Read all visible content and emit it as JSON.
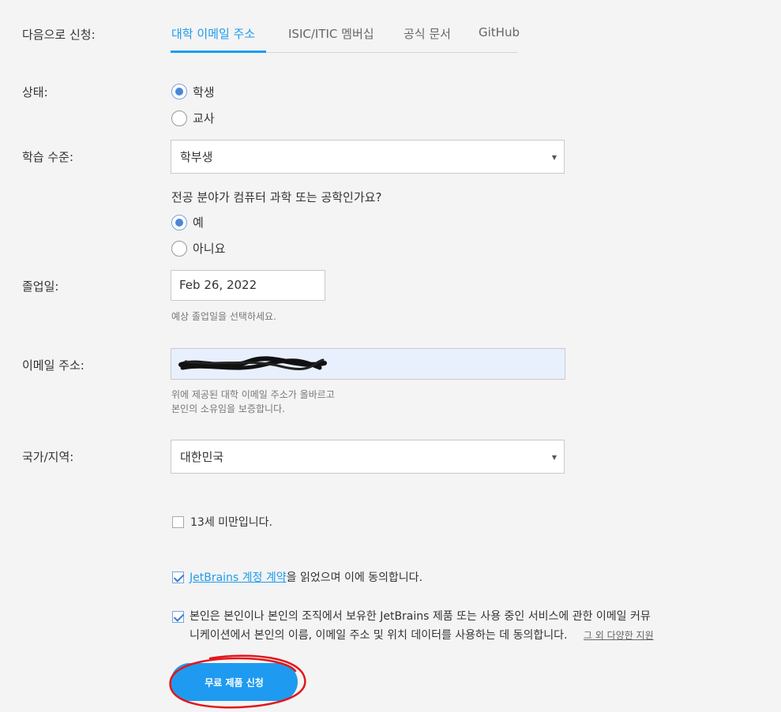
{
  "form": {
    "apply_with_label": "다음으로 신청:",
    "tabs": [
      {
        "label": "대학 이메일 주소",
        "active": true
      },
      {
        "label": "ISIC/ITIC 멤버십",
        "active": false
      },
      {
        "label": "공식 문서",
        "active": false
      },
      {
        "label": "GitHub",
        "active": false
      }
    ],
    "status": {
      "label": "상태:",
      "options": [
        {
          "label": "학생",
          "checked": true
        },
        {
          "label": "교사",
          "checked": false
        }
      ]
    },
    "study_level": {
      "label": "학습 수준:",
      "value": "학부생"
    },
    "major_question": {
      "label": "전공 분야가 컴퓨터 과학 또는 공학인가요?",
      "options": [
        {
          "label": "예",
          "checked": true
        },
        {
          "label": "아니요",
          "checked": false
        }
      ]
    },
    "graduation": {
      "label": "졸업일:",
      "value": "Feb 26, 2022",
      "hint": "예상 졸업일을 선택하세요."
    },
    "email": {
      "label": "이메일 주소:",
      "hint_line1": "위에 제공된 대학 이메일 주소가 올바르고",
      "hint_line2": "본인의 소유임을 보증합니다."
    },
    "country": {
      "label": "국가/지역:",
      "value": "대한민국"
    },
    "under13": {
      "label": "13세 미만입니다.",
      "checked": false
    },
    "agreement": {
      "link_text": "JetBrains 계정 계약",
      "rest_text": "을 읽었으며 이에 동의합니다.",
      "checked": true
    },
    "marketing": {
      "line1": "본인은 본인이나 본인의 조직에서 보유한 JetBrains 제품 또는 사용 중인 서비스에 관한 이메일 커뮤",
      "line2": "니케이션에서 본인의 이름, 이메일 주소 및 위치 데이터를 사용하는 데 동의합니다.",
      "more_link": "그 외 다양한 지원",
      "checked": true
    },
    "submit_label": "무료 제품 신청"
  },
  "colors": {
    "accent": "#1e9bf0",
    "annotation_red": "#e3161b",
    "email_field_bg": "#e8f0fe"
  }
}
